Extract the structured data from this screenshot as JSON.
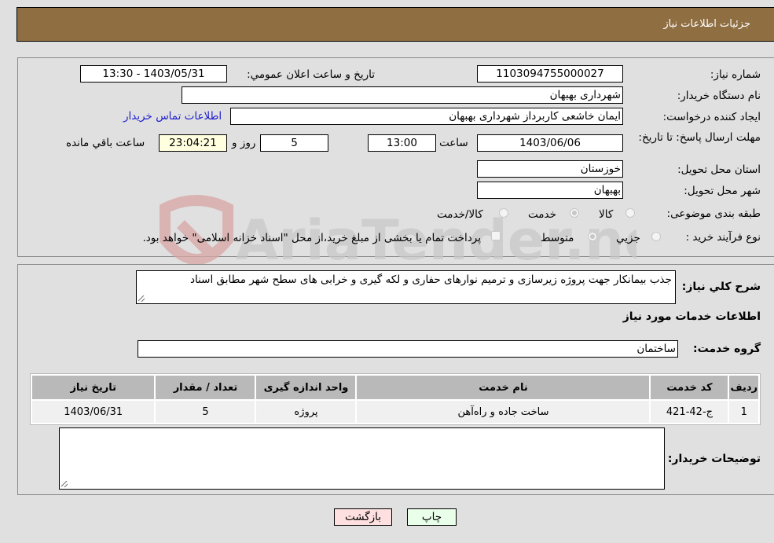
{
  "header": {
    "title": "جزئیات اطلاعات نیاز"
  },
  "form": {
    "need_number": {
      "label": "شماره نیاز:",
      "value": "1103094755000027"
    },
    "announce_datetime": {
      "label": "تاریخ و ساعت اعلان عمومي:",
      "value": "1403/05/31 - 13:30"
    },
    "buyer_org": {
      "label": "نام دستگاه خریدار:",
      "value": "شهرداری بهبهان"
    },
    "requester": {
      "label": "ایجاد کننده درخواست:",
      "value": "ایمان خاشعی کاربرداز شهرداری بهبهان"
    },
    "buyer_contact_link": "اطلاعات تماس خریدار",
    "deadline": {
      "label": "مهلت ارسال پاسخ: تا تاریخ:",
      "date": "1403/06/06",
      "time_label": "ساعت",
      "time": "13:00",
      "days": "5",
      "days_label": "روز و",
      "remaining": "23:04:21",
      "remaining_label": "ساعت باقي مانده"
    },
    "province": {
      "label": "استان محل تحویل:",
      "value": "خوزستان"
    },
    "city": {
      "label": "شهر محل تحویل:",
      "value": "بهبهان"
    },
    "category": {
      "label": "طبقه بندی موضوعی:",
      "options": [
        "کالا",
        "خدمت",
        "کالا/خدمت"
      ],
      "selected": "خدمت"
    },
    "purchase_type": {
      "label": "نوع فرآیند خرید :",
      "options": [
        "جزیي",
        "متوسط"
      ],
      "selected": "متوسط",
      "treasury_note": "پرداخت تمام یا بخشی از مبلغ خرید،از محل \"اسناد خزانه اسلامی\" خواهد بود."
    }
  },
  "details": {
    "description_label": "شرح کلي نیاز:",
    "description": "جذب بیمانکار جهت پروژه زیرسازی و ترمیم نوارهای حفاری و لکه گیری و خرابی های سطح شهر مطابق اسناد",
    "services_heading": "اطلاعات خدمات مورد نیاز",
    "service_group_label": "گروه خدمت:",
    "service_group": "ساختمان",
    "table": {
      "headers": [
        "ردیف",
        "کد خدمت",
        "نام خدمت",
        "واحد اندازه گیری",
        "تعداد / مقدار",
        "تاریخ نیاز"
      ],
      "rows": [
        [
          "1",
          "ج-42-421",
          "ساخت جاده و راه‌آهن",
          "پروژه",
          "5",
          "1403/06/31"
        ]
      ]
    },
    "buyer_notes_label": "توضیحات خریدار:",
    "buyer_notes": ""
  },
  "buttons": {
    "print": "چاپ",
    "back": "بازگشت"
  },
  "watermark": {
    "text": "AriaTender.neT"
  }
}
